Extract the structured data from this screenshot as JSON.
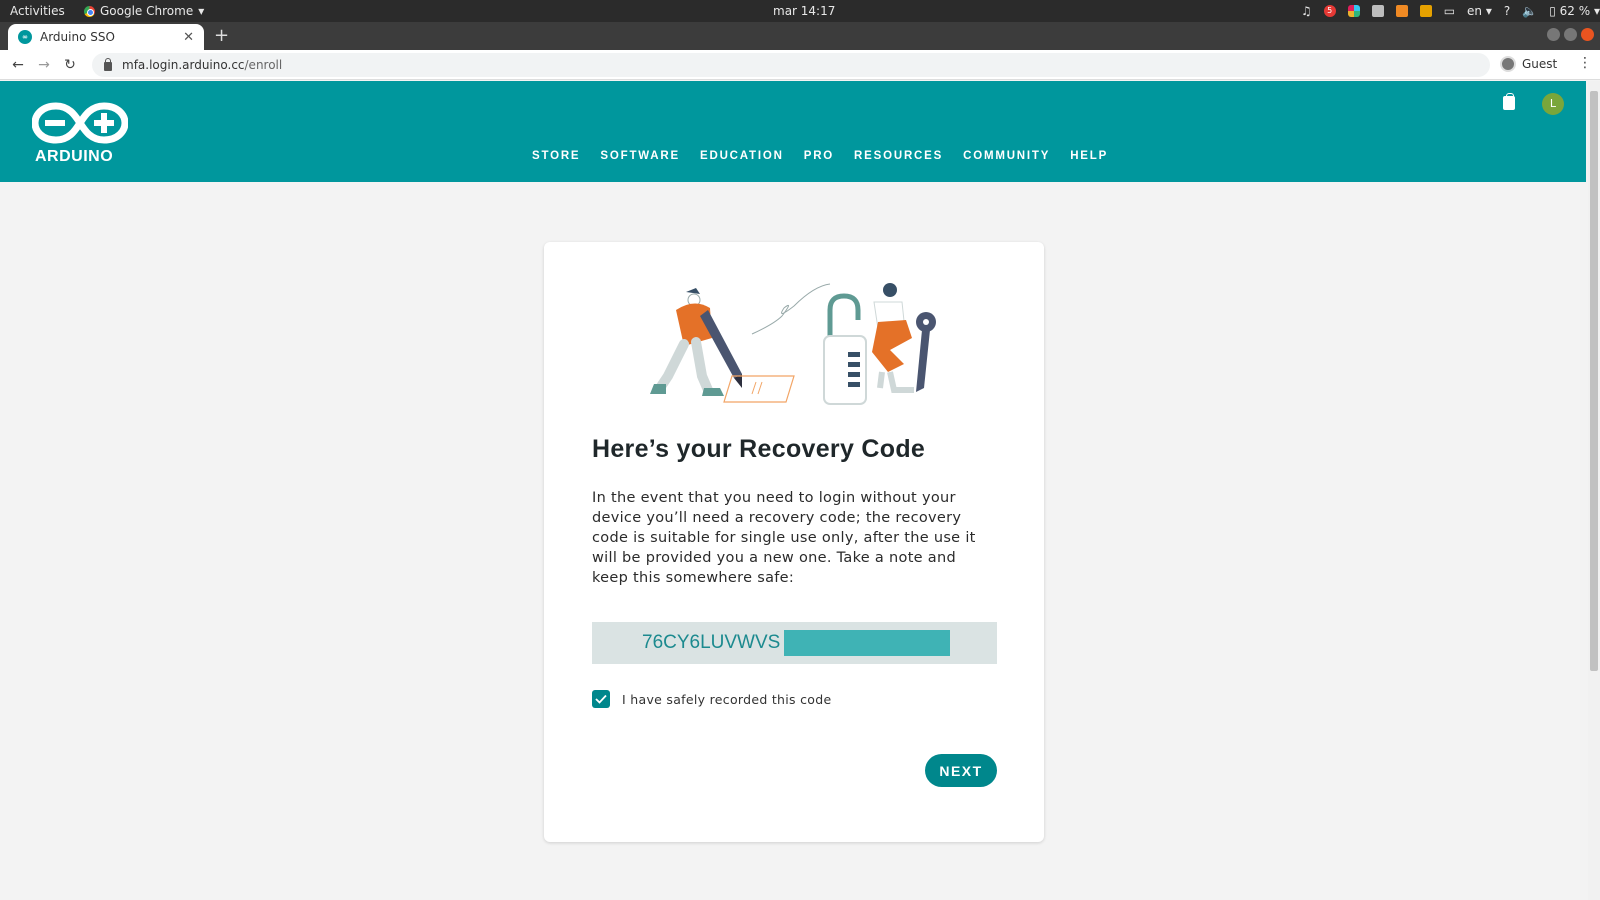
{
  "system_bar": {
    "activities": "Activities",
    "app_name": "Google Chrome",
    "clock": "mar 14:17",
    "notification_count": "5",
    "language": "en",
    "question": "?",
    "battery": "62 %"
  },
  "browser": {
    "tab_title": "Arduino SSO",
    "tab_favicon": "arduino-favicon",
    "url_host": "mfa.login.arduino.cc",
    "url_path": "/enroll",
    "profile_label": "Guest"
  },
  "site": {
    "brand": "ARDUINO",
    "nav": [
      "STORE",
      "SOFTWARE",
      "EDUCATION",
      "PRO",
      "RESOURCES",
      "COMMUNITY",
      "HELP"
    ],
    "avatar_initial": "L",
    "accent_color": "#00979d"
  },
  "card": {
    "title": "Here’s your Recovery Code",
    "description": "In the event that you need to login without your device you’ll need a recovery code; the recovery code is suitable for single use only, after the use it will be provided you a new one. Take a note and keep this somewhere safe:",
    "recovery_code": "76CY6LUVWVS",
    "checkbox_label": "I have safely recorded this code",
    "checkbox_checked": true,
    "next_label": "NEXT"
  }
}
